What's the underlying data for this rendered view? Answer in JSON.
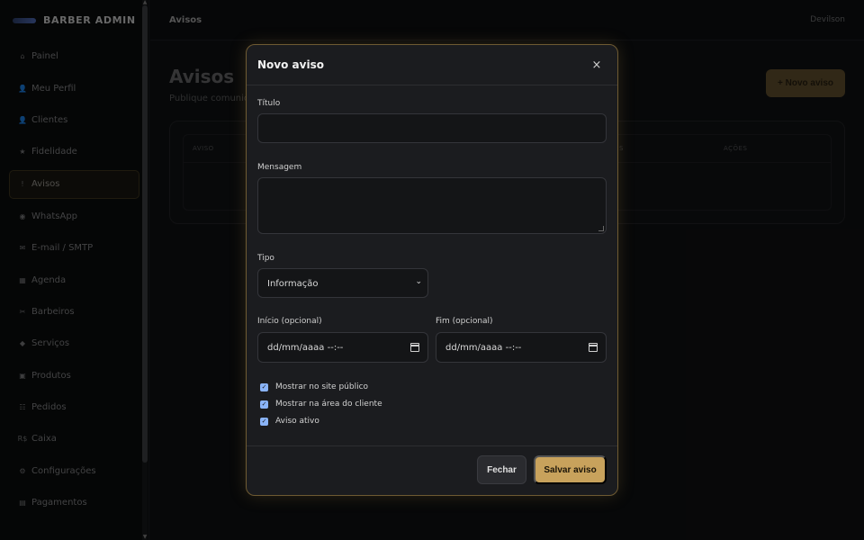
{
  "brand": {
    "name": "BARBER ADMIN"
  },
  "sidebar": {
    "items": [
      {
        "icon": "⌂",
        "label": "Painel"
      },
      {
        "icon": "👤",
        "label": "Meu Perfil"
      },
      {
        "icon": "👤",
        "label": "Clientes"
      },
      {
        "icon": "★",
        "label": "Fidelidade"
      },
      {
        "icon": "!",
        "label": "Avisos",
        "active": true
      },
      {
        "icon": "◉",
        "label": "WhatsApp"
      },
      {
        "icon": "✉",
        "label": "E-mail / SMTP"
      },
      {
        "icon": "▦",
        "label": "Agenda"
      },
      {
        "icon": "✂",
        "label": "Barbeiros"
      },
      {
        "icon": "◆",
        "label": "Serviços"
      },
      {
        "icon": "▣",
        "label": "Produtos"
      },
      {
        "icon": "☷",
        "label": "Pedidos"
      },
      {
        "icon": "R$",
        "label": "Caixa"
      },
      {
        "icon": "⚙",
        "label": "Configurações"
      },
      {
        "icon": "▤",
        "label": "Pagamentos"
      }
    ]
  },
  "topbar": {
    "title": "Avisos",
    "user": "Devilson"
  },
  "page": {
    "title": "Avisos",
    "subtitle": "Publique comunic",
    "new_button": "+ Novo aviso",
    "table_headers": {
      "aviso": "AVISO",
      "s": "S",
      "acoes": "AÇÕES"
    }
  },
  "modal": {
    "title": "Novo aviso",
    "close_icon": "×",
    "titulo_label": "Título",
    "titulo_value": "",
    "mensagem_label": "Mensagem",
    "mensagem_value": "",
    "tipo_label": "Tipo",
    "tipo_value": "Informação",
    "inicio_label": "Início (opcional)",
    "inicio_placeholder": "dd/mm/aaaa --:--",
    "fim_label": "Fim (opcional)",
    "fim_placeholder": "dd/mm/aaaa --:--",
    "checkboxes": [
      {
        "label": "Mostrar no site público",
        "checked": true
      },
      {
        "label": "Mostrar na área do cliente",
        "checked": true
      },
      {
        "label": "Aviso ativo",
        "checked": true
      }
    ],
    "fechar_label": "Fechar",
    "salvar_label": "Salvar aviso"
  },
  "colors": {
    "accent": "#c8a25c",
    "checkbox": "#8ab4f8",
    "modal_border": "#6e5a32"
  }
}
